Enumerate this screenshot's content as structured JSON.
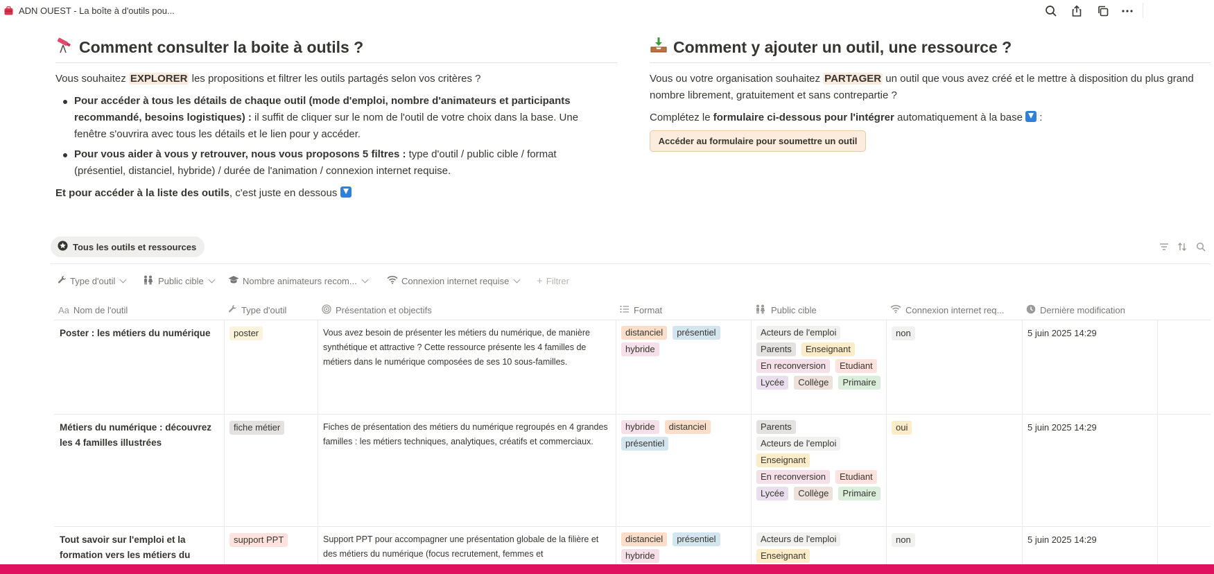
{
  "window": {
    "title": "ADN OUEST - La boîte à d'outils pou...",
    "icons": [
      "search-icon",
      "share-icon",
      "duplicate-icon",
      "more-icon"
    ]
  },
  "left_section": {
    "heading": "Comment consulter la boite à outils ?",
    "intro_before": "Vous souhaitez ",
    "intro_highlight": "EXPLORER",
    "intro_after": " les propositions et filtrer les outils partagés selon vos critères ?",
    "bullet1_bold": "Pour accéder à tous les détails de chaque outil (mode d'emploi, nombre d'animateurs et participants recommandé, besoins logistiques) :",
    "bullet1_text": " il suffit de cliquer sur le nom de l'outil de votre choix dans la base. Une fenêtre s'ouvrira avec tous les détails et le lien pour y accéder.",
    "bullet2_bold": "Pour vous aider à vous y retrouver, nous vous proposons 5 filtres :",
    "bullet2_text": " type d'outil / public cible / format (présentiel, distanciel, hybride) / durée de l'animation / connexion internet requise.",
    "closing_bold": "Et pour accéder à la liste des outils",
    "closing_text": ", c'est juste en dessous "
  },
  "right_section": {
    "heading": "Comment y ajouter un outil, une ressource ?",
    "intro_before": "Vous ou votre organisation souhaitez ",
    "intro_highlight": "PARTAGER",
    "intro_after": " un outil que vous avez créé et le mettre à disposition du plus grand nombre librement, gratuitement et sans contrepartie ?",
    "form_before": "Complétez le ",
    "form_bold": "formulaire ci-dessous pour l'intégrer",
    "form_after": " automatiquement à la base ",
    "form_colon": " :",
    "form_button": "Accéder au formulaire pour soumettre un outil"
  },
  "view": {
    "tab_label": "Tous les outils et ressources",
    "tools": [
      "filter-icon",
      "sort-icon",
      "search-icon"
    ]
  },
  "filters": [
    {
      "label": "Type d'outil",
      "icon": "wrench-icon"
    },
    {
      "label": "Public cible",
      "icon": "people-icon"
    },
    {
      "label": "Nombre animateurs recom...",
      "icon": "graduation-cap-icon"
    },
    {
      "label": "Connexion internet requise",
      "icon": "wifi-icon"
    },
    {
      "label": "Filtrer",
      "icon": "plus-icon"
    }
  ],
  "columns": [
    {
      "label": "Nom de l'outil",
      "icon": "text-icon"
    },
    {
      "label": "Type d'outil",
      "icon": "wrench-icon"
    },
    {
      "label": "Présentation et objectifs",
      "icon": "target-icon"
    },
    {
      "label": "Format",
      "icon": "list-icon"
    },
    {
      "label": "Public cible",
      "icon": "people-icon"
    },
    {
      "label": "Connexion internet req...",
      "icon": "wifi-icon"
    },
    {
      "label": "Dernière modification",
      "icon": "clock-icon"
    }
  ],
  "tag_colors": {
    "poster": "#fbf3db",
    "fiche métier": "#e3e2e0",
    "support PPT": "#ffe2dd",
    "distanciel": "#fadec9",
    "présentiel": "#d3e5ef",
    "hybride": "#f5e0e9",
    "Acteurs de l'emploi": "#f1f1ef",
    "Parents": "#e3e2e0",
    "Enseignant": "#fdecc8",
    "En reconversion": "#f5e0e9",
    "Etudiant": "#ffe2dd",
    "Lycée": "#e8deee",
    "Collège": "#eee0da",
    "Primaire": "#dbeddb",
    "non": "#f1f1ef",
    "oui": "#fdecc8"
  },
  "rows": [
    {
      "name": "Poster : les métiers du numérique",
      "type": "poster",
      "presentation": "Vous avez besoin de présenter les métiers du numérique, de manière synthétique et attractive ? Cette ressource présente les 4 familles de métiers dans le numérique composées de ses 10 sous-familles.",
      "format": [
        "distanciel",
        "présentiel",
        "hybride"
      ],
      "public": [
        "Acteurs de l'emploi",
        "Parents",
        "Enseignant",
        "En reconversion",
        "Etudiant",
        "Lycée",
        "Collège",
        "Primaire"
      ],
      "internet": "non",
      "modified": "5 juin 2025 14:29"
    },
    {
      "name": "Métiers du numérique : découvrez les 4 familles illustrées",
      "type": "fiche métier",
      "presentation": "Fiches de présentation des métiers du numérique regroupés en 4 grandes familles : les métiers techniques, analytiques, créatifs et commerciaux.",
      "format": [
        "hybride",
        "distanciel",
        "présentiel"
      ],
      "public": [
        "Parents",
        "Acteurs de l'emploi",
        "Enseignant",
        "En reconversion",
        "Etudiant",
        "Lycée",
        "Collège",
        "Primaire"
      ],
      "internet": "oui",
      "modified": "5 juin 2025 14:29"
    },
    {
      "name": "Tout savoir sur l'emploi et la formation vers les métiers du",
      "type": "support PPT",
      "presentation": "Support PPT pour accompagner une présentation globale de la filière et des métiers du numérique (focus recrutement, femmes et",
      "format": [
        "distanciel",
        "présentiel",
        "hybride"
      ],
      "public": [
        "Acteurs de l'emploi",
        "Enseignant"
      ],
      "internet": "non",
      "modified": "5 juin 2025 14:29"
    }
  ]
}
